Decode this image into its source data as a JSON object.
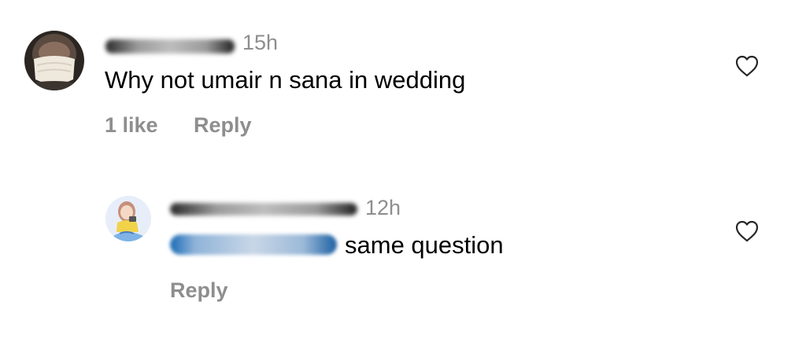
{
  "comments": [
    {
      "timestamp": "15h",
      "text": "Why not umair n sana in wedding",
      "likes_label": "1 like",
      "reply_label": "Reply",
      "avatar": "masked-person-photo"
    },
    {
      "timestamp": "12h",
      "text": "same question",
      "reply_label": "Reply",
      "avatar": "illustrated-girl-avatar"
    }
  ],
  "icons": {
    "like": "heart-outline-icon"
  },
  "colors": {
    "text": "#000000",
    "secondary": "#8e8e8e",
    "mention": "#1a6bb5"
  }
}
